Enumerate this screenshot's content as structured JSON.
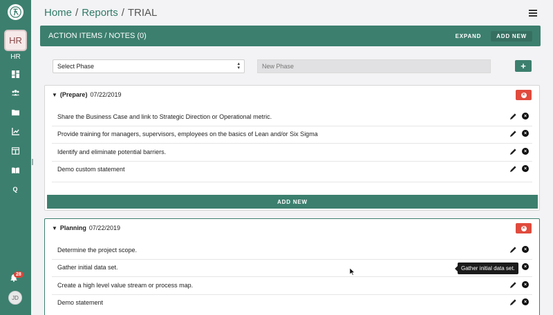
{
  "sidebar": {
    "logo_icon": "runner-logo-icon",
    "org_badge": "HR",
    "org_label": "HR",
    "icons": [
      "dashboard-icon",
      "users-icon",
      "folder-icon",
      "chart-icon",
      "table-icon",
      "book-icon",
      "q-icon"
    ],
    "q_label": "Q",
    "notifications_count": "28",
    "user_initials": "JD"
  },
  "breadcrumb": {
    "home": "Home",
    "sep1": "/",
    "reports": "Reports",
    "sep2": "/",
    "current": "TRIAL"
  },
  "action_bar": {
    "title": "ACTION ITEMS / NOTES (0)",
    "expand_label": "EXPAND",
    "add_new_label": "ADD NEW"
  },
  "phase_form": {
    "select_value": "Select Phase",
    "new_phase_placeholder": "New Phase",
    "add_label": "+"
  },
  "phases": [
    {
      "name": "(Prepare)",
      "date": "07/22/2019",
      "items": [
        "Share the Business Case and link to Strategic Direction or Operational metric.",
        "Provide training for managers, supervisors, employees on the basics of Lean and/or Six Sigma",
        "Identify and eliminate potential barriers.",
        "Demo custom statement"
      ],
      "add_new_label": "ADD NEW"
    },
    {
      "name": "Planning",
      "date": "07/22/2019",
      "items": [
        "Determine the project scope.",
        "Gather initial data set.",
        "Create a high level value stream or process map.",
        "Demo statement"
      ]
    }
  ],
  "tooltip": "Gather initial data set.",
  "colors": {
    "primary": "#3c7f6e",
    "danger": "#e04b3d",
    "background": "#f3f3f5"
  }
}
